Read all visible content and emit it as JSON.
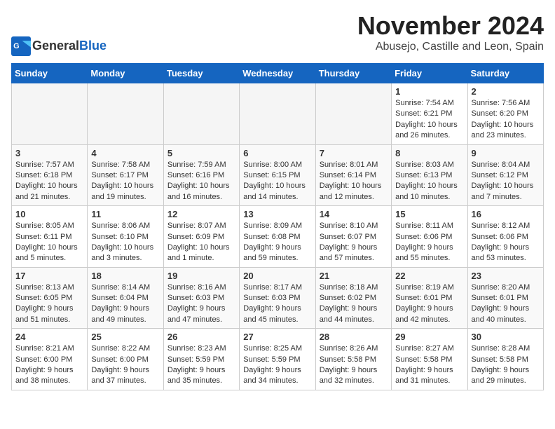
{
  "logo": {
    "general": "General",
    "blue": "Blue"
  },
  "title": "November 2024",
  "subtitle": "Abusejo, Castille and Leon, Spain",
  "days_header": [
    "Sunday",
    "Monday",
    "Tuesday",
    "Wednesday",
    "Thursday",
    "Friday",
    "Saturday"
  ],
  "weeks": [
    [
      {
        "day": "",
        "sunrise": "",
        "sunset": "",
        "daylight": ""
      },
      {
        "day": "",
        "sunrise": "",
        "sunset": "",
        "daylight": ""
      },
      {
        "day": "",
        "sunrise": "",
        "sunset": "",
        "daylight": ""
      },
      {
        "day": "",
        "sunrise": "",
        "sunset": "",
        "daylight": ""
      },
      {
        "day": "",
        "sunrise": "",
        "sunset": "",
        "daylight": ""
      },
      {
        "day": "1",
        "sunrise": "Sunrise: 7:54 AM",
        "sunset": "Sunset: 6:21 PM",
        "daylight": "Daylight: 10 hours and 26 minutes."
      },
      {
        "day": "2",
        "sunrise": "Sunrise: 7:56 AM",
        "sunset": "Sunset: 6:20 PM",
        "daylight": "Daylight: 10 hours and 23 minutes."
      }
    ],
    [
      {
        "day": "3",
        "sunrise": "Sunrise: 7:57 AM",
        "sunset": "Sunset: 6:18 PM",
        "daylight": "Daylight: 10 hours and 21 minutes."
      },
      {
        "day": "4",
        "sunrise": "Sunrise: 7:58 AM",
        "sunset": "Sunset: 6:17 PM",
        "daylight": "Daylight: 10 hours and 19 minutes."
      },
      {
        "day": "5",
        "sunrise": "Sunrise: 7:59 AM",
        "sunset": "Sunset: 6:16 PM",
        "daylight": "Daylight: 10 hours and 16 minutes."
      },
      {
        "day": "6",
        "sunrise": "Sunrise: 8:00 AM",
        "sunset": "Sunset: 6:15 PM",
        "daylight": "Daylight: 10 hours and 14 minutes."
      },
      {
        "day": "7",
        "sunrise": "Sunrise: 8:01 AM",
        "sunset": "Sunset: 6:14 PM",
        "daylight": "Daylight: 10 hours and 12 minutes."
      },
      {
        "day": "8",
        "sunrise": "Sunrise: 8:03 AM",
        "sunset": "Sunset: 6:13 PM",
        "daylight": "Daylight: 10 hours and 10 minutes."
      },
      {
        "day": "9",
        "sunrise": "Sunrise: 8:04 AM",
        "sunset": "Sunset: 6:12 PM",
        "daylight": "Daylight: 10 hours and 7 minutes."
      }
    ],
    [
      {
        "day": "10",
        "sunrise": "Sunrise: 8:05 AM",
        "sunset": "Sunset: 6:11 PM",
        "daylight": "Daylight: 10 hours and 5 minutes."
      },
      {
        "day": "11",
        "sunrise": "Sunrise: 8:06 AM",
        "sunset": "Sunset: 6:10 PM",
        "daylight": "Daylight: 10 hours and 3 minutes."
      },
      {
        "day": "12",
        "sunrise": "Sunrise: 8:07 AM",
        "sunset": "Sunset: 6:09 PM",
        "daylight": "Daylight: 10 hours and 1 minute."
      },
      {
        "day": "13",
        "sunrise": "Sunrise: 8:09 AM",
        "sunset": "Sunset: 6:08 PM",
        "daylight": "Daylight: 9 hours and 59 minutes."
      },
      {
        "day": "14",
        "sunrise": "Sunrise: 8:10 AM",
        "sunset": "Sunset: 6:07 PM",
        "daylight": "Daylight: 9 hours and 57 minutes."
      },
      {
        "day": "15",
        "sunrise": "Sunrise: 8:11 AM",
        "sunset": "Sunset: 6:06 PM",
        "daylight": "Daylight: 9 hours and 55 minutes."
      },
      {
        "day": "16",
        "sunrise": "Sunrise: 8:12 AM",
        "sunset": "Sunset: 6:06 PM",
        "daylight": "Daylight: 9 hours and 53 minutes."
      }
    ],
    [
      {
        "day": "17",
        "sunrise": "Sunrise: 8:13 AM",
        "sunset": "Sunset: 6:05 PM",
        "daylight": "Daylight: 9 hours and 51 minutes."
      },
      {
        "day": "18",
        "sunrise": "Sunrise: 8:14 AM",
        "sunset": "Sunset: 6:04 PM",
        "daylight": "Daylight: 9 hours and 49 minutes."
      },
      {
        "day": "19",
        "sunrise": "Sunrise: 8:16 AM",
        "sunset": "Sunset: 6:03 PM",
        "daylight": "Daylight: 9 hours and 47 minutes."
      },
      {
        "day": "20",
        "sunrise": "Sunrise: 8:17 AM",
        "sunset": "Sunset: 6:03 PM",
        "daylight": "Daylight: 9 hours and 45 minutes."
      },
      {
        "day": "21",
        "sunrise": "Sunrise: 8:18 AM",
        "sunset": "Sunset: 6:02 PM",
        "daylight": "Daylight: 9 hours and 44 minutes."
      },
      {
        "day": "22",
        "sunrise": "Sunrise: 8:19 AM",
        "sunset": "Sunset: 6:01 PM",
        "daylight": "Daylight: 9 hours and 42 minutes."
      },
      {
        "day": "23",
        "sunrise": "Sunrise: 8:20 AM",
        "sunset": "Sunset: 6:01 PM",
        "daylight": "Daylight: 9 hours and 40 minutes."
      }
    ],
    [
      {
        "day": "24",
        "sunrise": "Sunrise: 8:21 AM",
        "sunset": "Sunset: 6:00 PM",
        "daylight": "Daylight: 9 hours and 38 minutes."
      },
      {
        "day": "25",
        "sunrise": "Sunrise: 8:22 AM",
        "sunset": "Sunset: 6:00 PM",
        "daylight": "Daylight: 9 hours and 37 minutes."
      },
      {
        "day": "26",
        "sunrise": "Sunrise: 8:23 AM",
        "sunset": "Sunset: 5:59 PM",
        "daylight": "Daylight: 9 hours and 35 minutes."
      },
      {
        "day": "27",
        "sunrise": "Sunrise: 8:25 AM",
        "sunset": "Sunset: 5:59 PM",
        "daylight": "Daylight: 9 hours and 34 minutes."
      },
      {
        "day": "28",
        "sunrise": "Sunrise: 8:26 AM",
        "sunset": "Sunset: 5:58 PM",
        "daylight": "Daylight: 9 hours and 32 minutes."
      },
      {
        "day": "29",
        "sunrise": "Sunrise: 8:27 AM",
        "sunset": "Sunset: 5:58 PM",
        "daylight": "Daylight: 9 hours and 31 minutes."
      },
      {
        "day": "30",
        "sunrise": "Sunrise: 8:28 AM",
        "sunset": "Sunset: 5:58 PM",
        "daylight": "Daylight: 9 hours and 29 minutes."
      }
    ]
  ]
}
